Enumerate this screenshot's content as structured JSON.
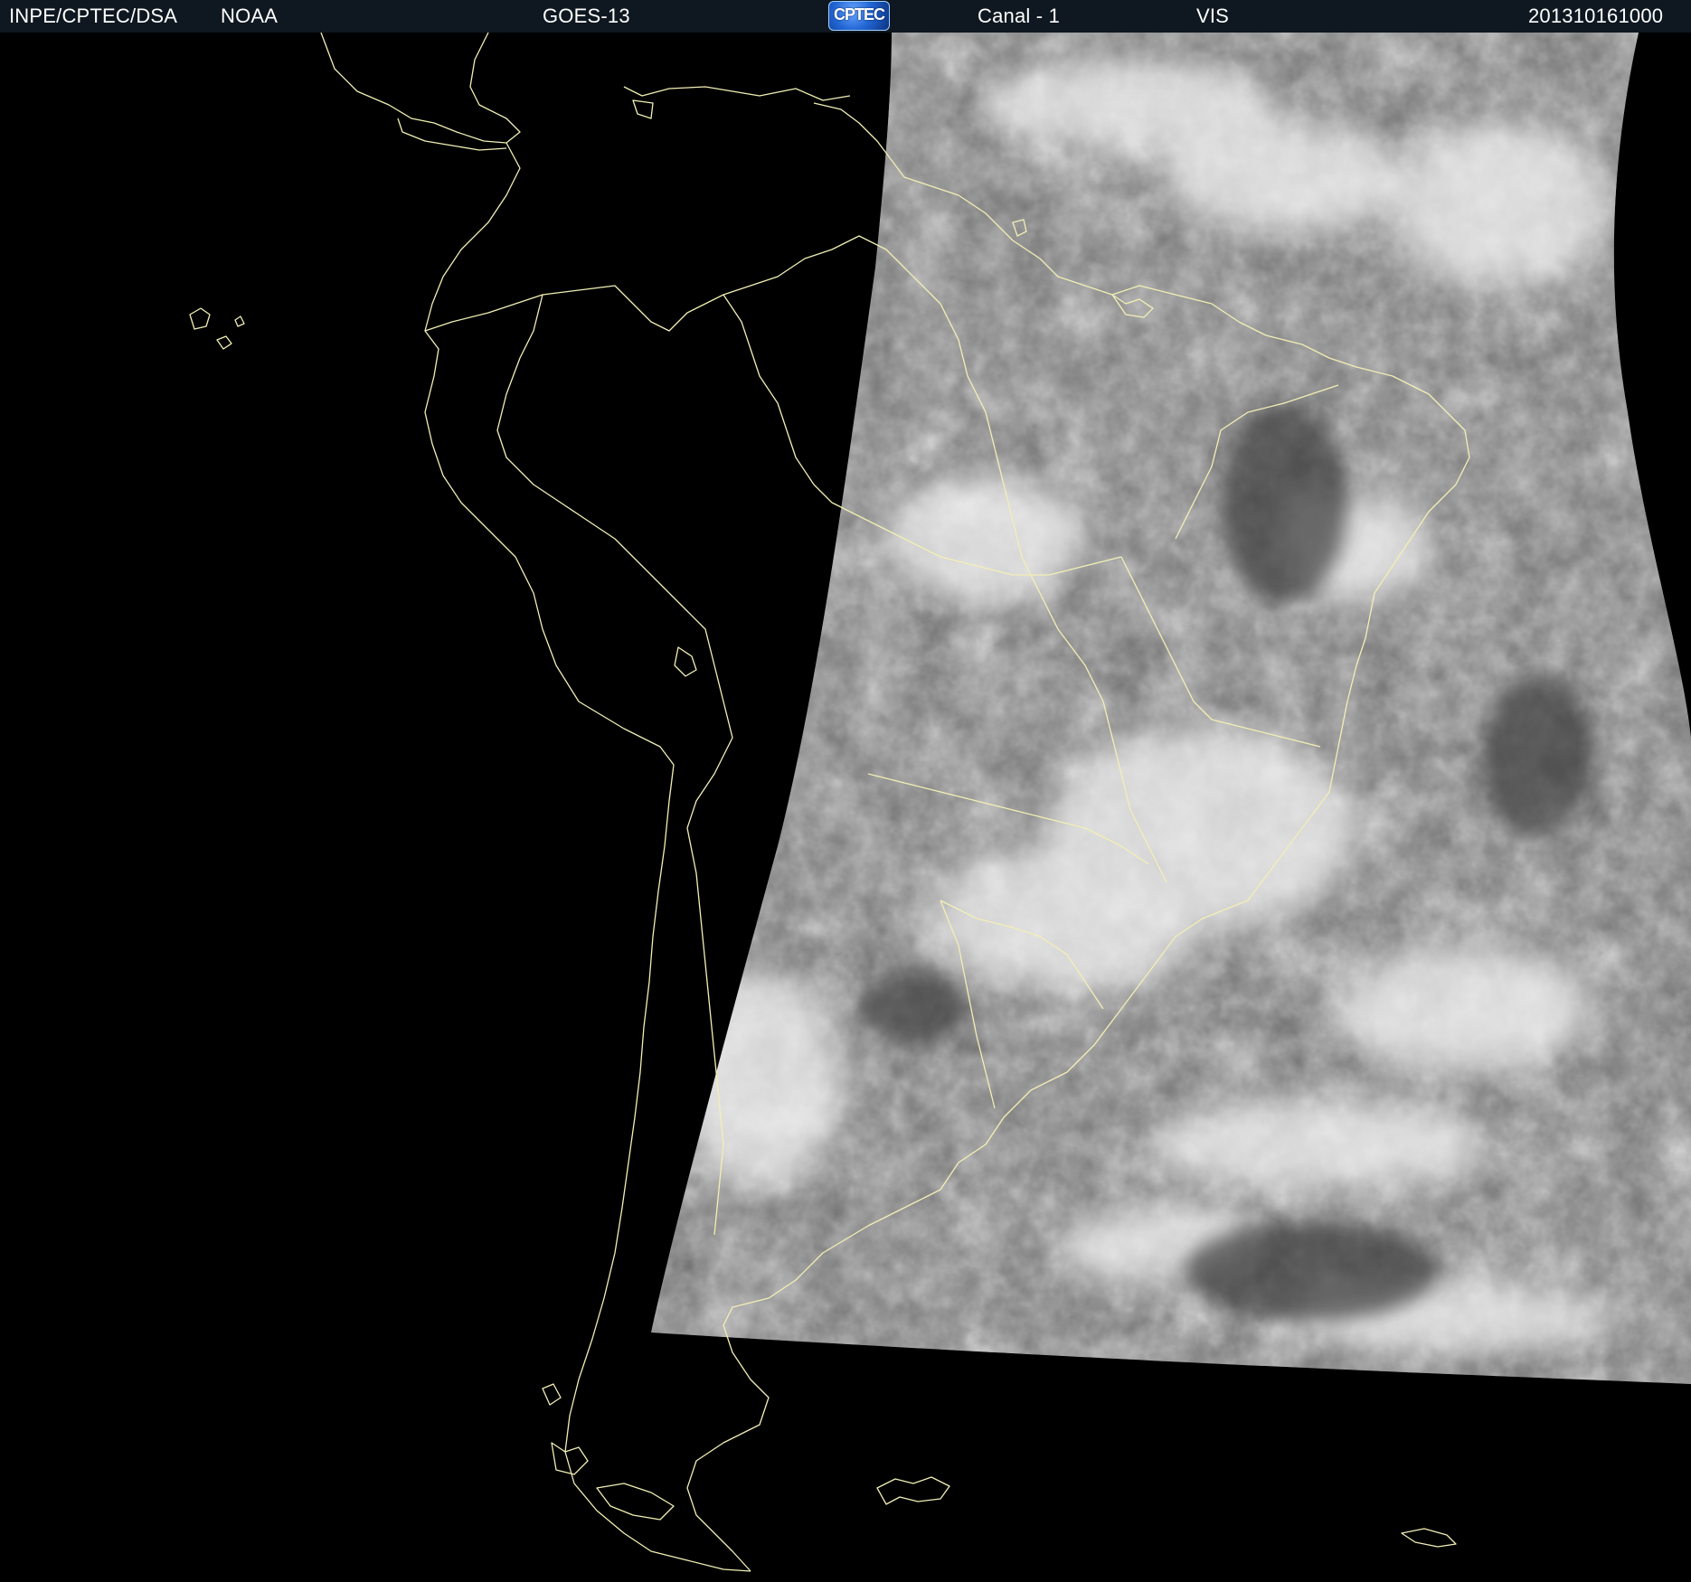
{
  "header": {
    "source": "INPE/CPTEC/DSA",
    "agency": "NOAA",
    "satellite": "GOES-13",
    "logo_text": "CPTEC",
    "channel": "Canal - 1",
    "band": "VIS",
    "timestamp": "201310161000"
  },
  "colors": {
    "header_bg": "#0f1820",
    "header_text": "#ffffff",
    "map_background": "#000000",
    "coastline": "#f2efb5",
    "cloud_base": "#6e6e6e"
  },
  "map": {
    "image_type": "satellite visible channel",
    "region": "South America"
  }
}
